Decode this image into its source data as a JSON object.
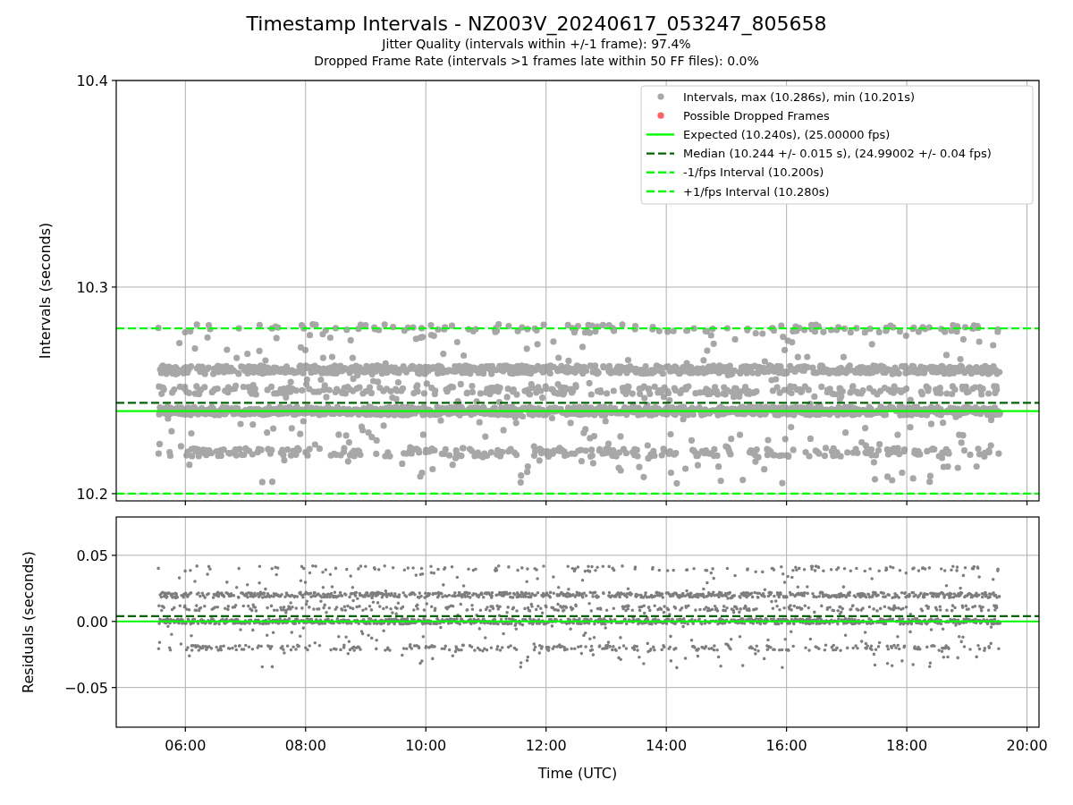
{
  "title": "Timestamp Intervals - NZ003V_20240617_053247_805658",
  "subtitles": [
    "Jitter Quality (intervals within +/-1 frame): 97.4%",
    "Dropped Frame Rate (intervals >1 frames late within 50 FF files): 0.0%"
  ],
  "intervals_panel": {
    "scatter_legend": [
      {
        "label": "Intervals, max (10.286s), min (10.201s)",
        "color": "#a8a8a8"
      },
      {
        "label": "Possible Dropped Frames",
        "color": "#ff6060"
      }
    ],
    "chart_data": {
      "type": "line",
      "ylabel": "Intervals (seconds)",
      "x": [
        4.85,
        20.2
      ],
      "xlim": [
        4.85,
        20.2
      ],
      "grid": true,
      "legend": "upper right",
      "ylim": [
        10.1965,
        10.4
      ],
      "yticks": [
        {
          "value": 10.2,
          "label": "10.2"
        },
        {
          "value": 10.3,
          "label": "10.3"
        },
        {
          "value": 10.4,
          "label": "10.4"
        }
      ],
      "series": [
        {
          "name": "Expected (10.240s), (25.00000 fps)",
          "color": "#00ff00",
          "line_style": "solid",
          "values": [
            10.24,
            10.24
          ]
        },
        {
          "name": "Median (10.244 +/- 0.015 s), (24.99002 +/- 0.04 fps)",
          "color": "#006400",
          "line_style": "dashed",
          "values": [
            10.244,
            10.244
          ]
        },
        {
          "name": "-1/fps Interval (10.200s)",
          "color": "#00ff00",
          "line_style": "dashed",
          "values": [
            10.2,
            10.2
          ]
        },
        {
          "name": "+1/fps Interval (10.280s)",
          "color": "#00ff00",
          "line_style": "dashed",
          "values": [
            10.28,
            10.28
          ]
        }
      ]
    }
  },
  "residuals_panel": {
    "chart_data": {
      "type": "line",
      "xlabel": "Time (UTC)",
      "ylabel": "Residuals (seconds)",
      "x": [
        4.85,
        20.2
      ],
      "xlim": [
        4.85,
        20.2
      ],
      "grid": true,
      "xticks": [
        {
          "value": 6,
          "label": "06:00"
        },
        {
          "value": 8,
          "label": "08:00"
        },
        {
          "value": 10,
          "label": "10:00"
        },
        {
          "value": 12,
          "label": "12:00"
        },
        {
          "value": 14,
          "label": "14:00"
        },
        {
          "value": 16,
          "label": "16:00"
        },
        {
          "value": 18,
          "label": "18:00"
        },
        {
          "value": 20,
          "label": "20:00"
        }
      ],
      "ylim": [
        -0.08,
        0.079
      ],
      "yticks": [
        {
          "value": -0.05,
          "label": "−0.05"
        },
        {
          "value": 0,
          "label": "0.00"
        },
        {
          "value": 0.05,
          "label": "0.05"
        }
      ],
      "series": [
        {
          "color": "#00ff00",
          "line_style": "solid",
          "values": [
            0,
            0
          ]
        },
        {
          "color": "#006400",
          "line_style": "dashed",
          "values": [
            0.004,
            0.004
          ]
        }
      ]
    }
  }
}
